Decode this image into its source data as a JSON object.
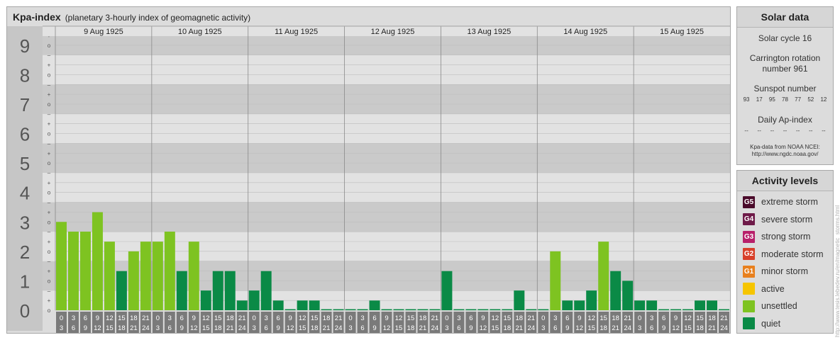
{
  "header": {
    "title": "Kpa-index",
    "subtitle": "(planetary 3-hourly index of geomagnetic activity)"
  },
  "chart_data": {
    "type": "bar",
    "title": "Kpa-index",
    "subtitle": "(planetary 3-hourly index of geomagnetic activity)",
    "ylim": [
      0,
      9
    ],
    "y_ticks": [
      "0",
      "1",
      "2",
      "3",
      "4",
      "5",
      "6",
      "7",
      "8",
      "9"
    ],
    "y_minor_ticks": [
      "-",
      "o",
      "+"
    ],
    "days": [
      "9 Aug 1925",
      "10 Aug 1925",
      "11 Aug 1925",
      "12 Aug 1925",
      "13 Aug 1925",
      "14 Aug 1925",
      "15 Aug 1925"
    ],
    "interval_start_labels": [
      "0",
      "3",
      "6",
      "9",
      "12",
      "15",
      "18",
      "21"
    ],
    "interval_end_labels": [
      "3",
      "6",
      "9",
      "12",
      "15",
      "18",
      "21",
      "24"
    ],
    "values": [
      [
        3.0,
        2.67,
        2.67,
        3.33,
        2.33,
        1.33,
        2.0,
        2.33
      ],
      [
        2.33,
        2.67,
        1.33,
        2.33,
        0.67,
        1.33,
        1.33,
        0.33
      ],
      [
        0.67,
        1.33,
        0.33,
        0.0,
        0.33,
        0.33,
        0.0,
        0.0
      ],
      [
        0.0,
        0.0,
        0.33,
        0.0,
        0.0,
        0.0,
        0.0,
        0.0
      ],
      [
        1.33,
        0.0,
        0.0,
        0.0,
        0.0,
        0.0,
        0.67,
        0.0
      ],
      [
        0.0,
        2.0,
        0.33,
        0.33,
        0.67,
        2.33,
        1.33,
        1.0
      ],
      [
        0.33,
        0.33,
        0.0,
        0.0,
        0.0,
        0.33,
        0.33,
        0.0
      ]
    ],
    "colors": {
      "quiet": "#0a8a46",
      "unsettled": "#7ec321",
      "row_light": "#e2e2e2",
      "row_dark": "#cacaca",
      "axis_label_bg": "#c6c6c6",
      "axis_label_text": "#555555",
      "interval_cell_bg": "#7a7a7a"
    }
  },
  "solar": {
    "title": "Solar data",
    "cycle": "Solar cycle 16",
    "carrington": "Carrington rotation number 961",
    "sunspot_title": "Sunspot number",
    "sunspot_values": [
      "93",
      "17",
      "95",
      "78",
      "77",
      "52",
      "12"
    ],
    "ap_title": "Daily Ap-index",
    "ap_values": [
      "--",
      "--",
      "--",
      "--",
      "--",
      "--",
      "--"
    ],
    "credit_line1": "Kpa-data from NOAA NCEI:",
    "credit_line2": "http://www.ngdc.noaa.gov/"
  },
  "activity": {
    "title": "Activity levels",
    "levels": [
      {
        "code": "G5",
        "label": "extreme storm",
        "color": "#4a0a2a"
      },
      {
        "code": "G4",
        "label": "severe storm",
        "color": "#6e1a48"
      },
      {
        "code": "G3",
        "label": "strong storm",
        "color": "#b8206a"
      },
      {
        "code": "G2",
        "label": "moderate storm",
        "color": "#d8402a"
      },
      {
        "code": "G1",
        "label": "minor storm",
        "color": "#e8801e"
      },
      {
        "code": "",
        "label": "active",
        "color": "#f6c500"
      },
      {
        "code": "",
        "label": "unsettled",
        "color": "#7ec321"
      },
      {
        "code": "",
        "label": "quiet",
        "color": "#0a8a46"
      }
    ]
  },
  "watermark": "http://www.tesis.lebedev.ru/en/magnetic_storms.html"
}
